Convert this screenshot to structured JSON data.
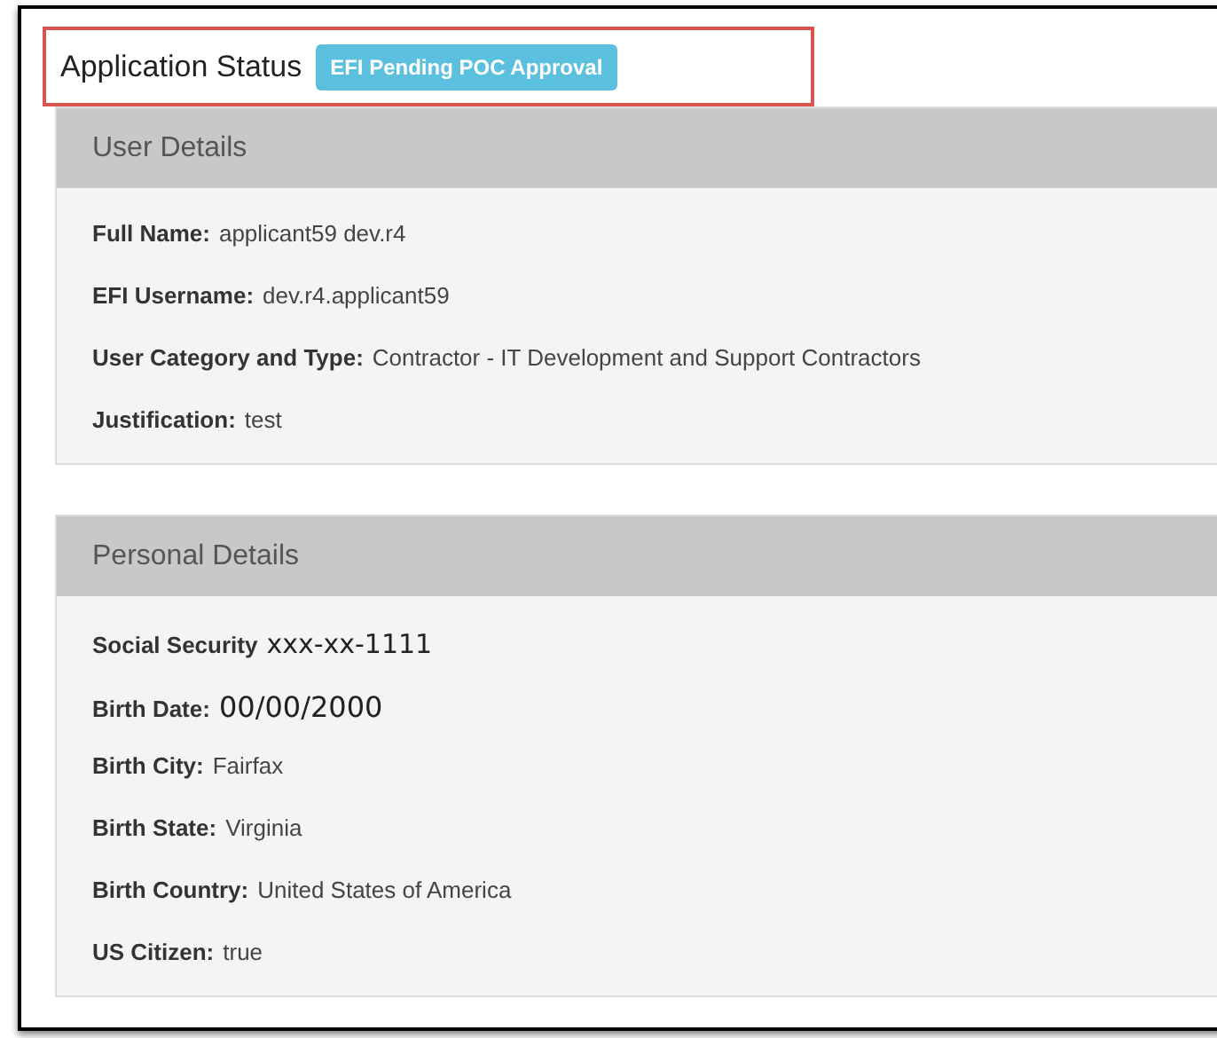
{
  "title": "Application Status",
  "status_badge": "EFI Pending POC Approval",
  "panels": [
    {
      "heading": "User Details",
      "fields": [
        {
          "label": "Full Name:",
          "value": "applicant59 dev.r4",
          "kind": "plain"
        },
        {
          "label": "EFI Username:",
          "value": "dev.r4.applicant59",
          "kind": "plain"
        },
        {
          "label": "User Category and Type:",
          "value": "Contractor - IT Development and Support Contractors",
          "kind": "plain"
        },
        {
          "label": "Justification:",
          "value": "test",
          "kind": "plain"
        }
      ]
    },
    {
      "heading": "Personal Details",
      "fields": [
        {
          "label": "Social Security",
          "value": "xxx-xx-1111",
          "kind": "large"
        },
        {
          "label": "Birth Date:",
          "value": "00/00/2000",
          "kind": "larger"
        },
        {
          "label": "Birth City:",
          "value": "Fairfax",
          "kind": "plain"
        },
        {
          "label": "Birth State:",
          "value": "Virginia",
          "kind": "plain"
        },
        {
          "label": "Birth Country:",
          "value": "United States of America",
          "kind": "plain"
        },
        {
          "label": "US Citizen:",
          "value": "true",
          "kind": "plain"
        }
      ]
    }
  ]
}
